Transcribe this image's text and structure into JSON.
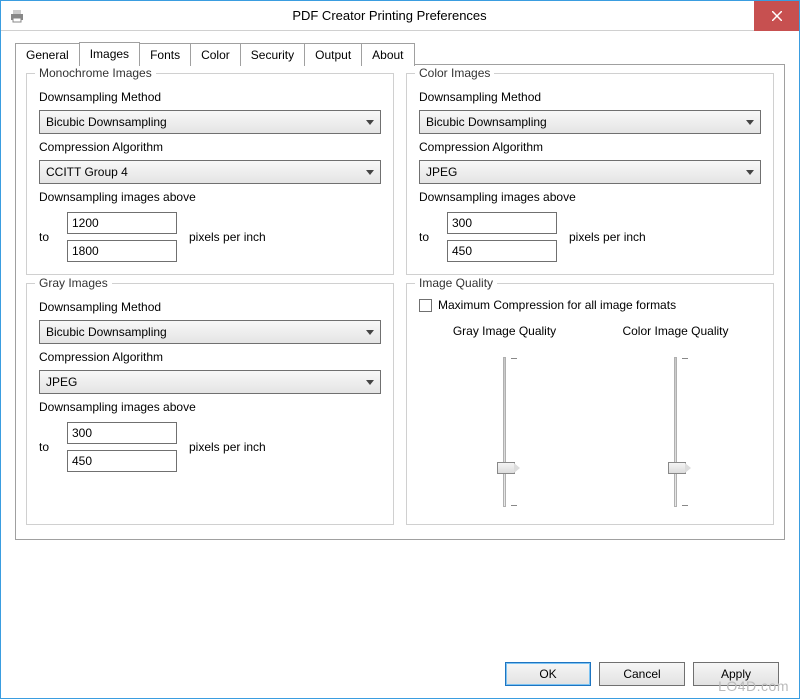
{
  "window": {
    "title": "PDF Creator Printing Preferences"
  },
  "tabs": [
    "General",
    "Images",
    "Fonts",
    "Color",
    "Security",
    "Output",
    "About"
  ],
  "mono": {
    "title": "Monochrome Images",
    "ds_label": "Downsampling Method",
    "ds_value": "Bicubic Downsampling",
    "comp_label": "Compression Algorithm",
    "comp_value": "CCITT Group 4",
    "above_label": "Downsampling images above",
    "to": "to",
    "v1": "1200",
    "v2": "1800",
    "ppi": "pixels per inch"
  },
  "color": {
    "title": "Color Images",
    "ds_label": "Downsampling Method",
    "ds_value": "Bicubic Downsampling",
    "comp_label": "Compression Algorithm",
    "comp_value": "JPEG",
    "above_label": "Downsampling images above",
    "to": "to",
    "v1": "300",
    "v2": "450",
    "ppi": "pixels per inch"
  },
  "gray": {
    "title": "Gray Images",
    "ds_label": "Downsampling Method",
    "ds_value": "Bicubic Downsampling",
    "comp_label": "Compression Algorithm",
    "comp_value": "JPEG",
    "above_label": "Downsampling images above",
    "to": "to",
    "v1": "300",
    "v2": "450",
    "ppi": "pixels per inch"
  },
  "quality": {
    "title": "Image Quality",
    "maxcomp": "Maximum Compression for all image formats",
    "gray_label": "Gray Image Quality",
    "color_label": "Color Image Quality"
  },
  "buttons": {
    "ok": "OK",
    "cancel": "Cancel",
    "apply": "Apply"
  },
  "watermark": "LO4D.com"
}
